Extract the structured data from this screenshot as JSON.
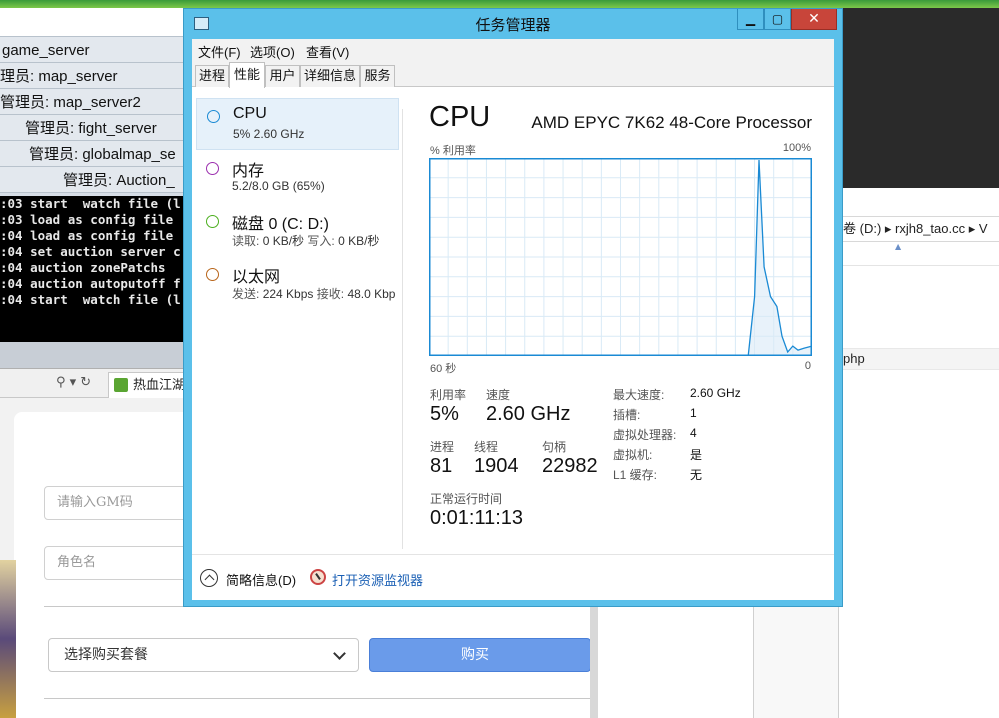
{
  "background": {
    "managers": [
      "game_server",
      "理员: map_server",
      "管理员: map_server2",
      "管理员: fight_server",
      "管理员: globalmap_se",
      "管理员: Auction_"
    ],
    "console_lines": [
      ":03 start  watch file (l",
      ":03 load as config file",
      ":04 load as config file",
      ":04 set auction server c",
      ":04 auction zonePatchs",
      ":04 auction autoputoff f",
      ":04 start  watch file (l"
    ],
    "browser": {
      "search_icons": "⚲ ▾ ↻",
      "tab_label": "热血江湖"
    },
    "form": {
      "gm_code_placeholder": "请输入GM码",
      "role_name_placeholder": "角色名",
      "package_select": "选择购买套餐",
      "buy_button": "购买"
    },
    "explorer": {
      "address": "卷 (D:)  ▸  rxjh8_tao.cc  ▸  V",
      "file_row": "php"
    }
  },
  "task_manager": {
    "title": "任务管理器",
    "window_buttons": {
      "minimize": "▁",
      "maximize": "▢",
      "close": "✕"
    },
    "menu": [
      "文件(F)",
      "选项(O)",
      "查看(V)"
    ],
    "tabs": [
      "进程",
      "性能",
      "用户",
      "详细信息",
      "服务"
    ],
    "active_tab": "性能",
    "resources": [
      {
        "name": "CPU",
        "sub": "5% 2.60 GHz",
        "color": "#1a8ad4"
      },
      {
        "name": "内存",
        "sub": "5.2/8.0 GB (65%)",
        "color": "#9b2fae"
      },
      {
        "name": "磁盘 0 (C: D:)",
        "sub_read_label": "读取:",
        "sub_read": "0 KB/秒",
        "sub_write_label": "写入:",
        "sub_write": "0 KB/秒",
        "color": "#4caf1f"
      },
      {
        "name": "以太网",
        "sub_send_label": "发送:",
        "sub_send": "224 Kbps",
        "sub_recv_label": "接收:",
        "sub_recv": "48.0 Kbp",
        "color": "#b8651a"
      }
    ],
    "detail": {
      "title": "CPU",
      "model": "AMD EPYC 7K62 48-Core Processor",
      "util_axis_label": "% 利用率",
      "util_axis_max": "100%",
      "time_axis_left": "60 秒",
      "time_axis_right": "0",
      "stats": {
        "utilization_label": "利用率",
        "utilization": "5%",
        "speed_label": "速度",
        "speed": "2.60 GHz",
        "processes_label": "进程",
        "processes": "81",
        "threads_label": "线程",
        "threads": "1904",
        "handles_label": "句柄",
        "handles": "22982",
        "uptime_label": "正常运行时间",
        "uptime": "0:01:11:13"
      },
      "specs": [
        {
          "label": "最大速度:",
          "value": "2.60 GHz"
        },
        {
          "label": "插槽:",
          "value": "1"
        },
        {
          "label": "虚拟处理器:",
          "value": "4"
        },
        {
          "label": "虚拟机:",
          "value": "是"
        },
        {
          "label": "L1 缓存:",
          "value": "无"
        }
      ],
      "graph_line_color": "#1a8ad4",
      "graph_grid_color": "#d9eaf6"
    },
    "footer": {
      "brief": "简略信息(D)",
      "open_monitor": "打开资源监视器"
    }
  },
  "chart_data": {
    "type": "area",
    "x_label": "60 秒",
    "y_label": "% 利用率",
    "xlim": [
      60,
      0
    ],
    "ylim": [
      0,
      100
    ],
    "x_seconds_ago": [
      60,
      10,
      9,
      8.3,
      7.5,
      6.5,
      5.5,
      4.7,
      3.8,
      3.0,
      2.2,
      1.2,
      0
    ],
    "utilization": [
      0,
      0,
      30,
      99,
      45,
      30,
      25,
      10,
      2,
      5,
      3,
      4,
      5
    ]
  }
}
